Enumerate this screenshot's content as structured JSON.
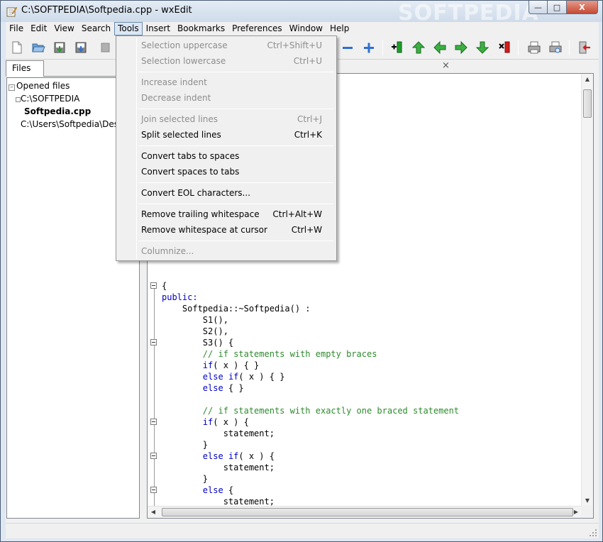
{
  "window": {
    "title": "C:\\SOFTPEDIA\\Softpedia.cpp - wxEdit",
    "watermark": "SOFTPEDIA",
    "minimize_glyph": "—",
    "maximize_glyph": "□",
    "close_glyph": "X"
  },
  "menubar": {
    "items": [
      {
        "label": "File"
      },
      {
        "label": "Edit"
      },
      {
        "label": "View"
      },
      {
        "label": "Search"
      },
      {
        "label": "Tools"
      },
      {
        "label": "Insert"
      },
      {
        "label": "Bookmarks"
      },
      {
        "label": "Preferences"
      },
      {
        "label": "Window"
      },
      {
        "label": "Help"
      }
    ],
    "active": "Tools"
  },
  "toolbar": {
    "icons": [
      "new-file-icon",
      "open-file-icon",
      "save-icon",
      "save-as-icon",
      "close-file-icon",
      "zoom-out-icon",
      "zoom-in-icon",
      "toggle-bookmark-icon",
      "first-bookmark-icon",
      "previous-bookmark-icon",
      "next-bookmark-icon",
      "last-bookmark-icon",
      "clear-bookmarks-icon",
      "print-icon",
      "print-preview-icon",
      "exit-icon"
    ],
    "colors": {
      "green": "#1f9e2a",
      "blue": "#2f6fd0",
      "red": "#d21c1c"
    }
  },
  "files_pane": {
    "tab_label": "Files",
    "tree": {
      "root": "Opened files",
      "folder1": "C:\\SOFTPEDIA",
      "file1": "Softpedia.cpp",
      "folder2": "C:\\Users\\Softpedia\\Desktop"
    }
  },
  "tools_menu": {
    "items": [
      {
        "label": "Selection uppercase",
        "shortcut": "Ctrl+Shift+U",
        "enabled": false
      },
      {
        "label": "Selection lowercase",
        "shortcut": "Ctrl+U",
        "enabled": false
      },
      {
        "label": "Increase indent",
        "shortcut": "",
        "enabled": false
      },
      {
        "label": "Decrease indent",
        "shortcut": "",
        "enabled": false
      },
      {
        "label": "Join selected lines",
        "shortcut": "Ctrl+J",
        "enabled": false
      },
      {
        "label": "Split selected lines",
        "shortcut": "Ctrl+K",
        "enabled": true
      },
      {
        "label": "Convert tabs to spaces",
        "shortcut": "",
        "enabled": true
      },
      {
        "label": "Convert spaces to tabs",
        "shortcut": "",
        "enabled": true
      },
      {
        "label": "Convert EOL characters...",
        "shortcut": "",
        "enabled": true
      },
      {
        "label": "Remove trailing whitespace",
        "shortcut": "Ctrl+Alt+W",
        "enabled": true
      },
      {
        "label": "Remove whitespace at cursor",
        "shortcut": "Ctrl+W",
        "enabled": true
      },
      {
        "label": "Columnize...",
        "shortcut": "",
        "enabled": false
      }
    ]
  },
  "editor": {
    "close_glyph": "×",
    "lines": [
      {
        "t": "{",
        "k": ""
      },
      {
        "t": "public:",
        "k": "kw"
      },
      {
        "t": "    Softpedia::~Softpedia() :",
        "k": ""
      },
      {
        "t": "        S1(),",
        "k": ""
      },
      {
        "t": "        S2(),",
        "k": ""
      },
      {
        "t": "        S3() {",
        "k": ""
      },
      {
        "t": "        // if statements with empty braces",
        "k": "cm"
      },
      {
        "t": "        if( x ) { }",
        "k": "if"
      },
      {
        "t": "        else if( x ) { }",
        "k": "elseif"
      },
      {
        "t": "        else { }",
        "k": "else"
      },
      {
        "t": "",
        "k": ""
      },
      {
        "t": "        // if statements with exactly one braced statement",
        "k": "cm"
      },
      {
        "t": "        if( x ) {",
        "k": "if"
      },
      {
        "t": "            statement;",
        "k": ""
      },
      {
        "t": "        }",
        "k": ""
      },
      {
        "t": "        else if( x ) {",
        "k": "elseif"
      },
      {
        "t": "            statement;",
        "k": ""
      },
      {
        "t": "        }",
        "k": ""
      },
      {
        "t": "        else {",
        "k": "else"
      },
      {
        "t": "            statement;",
        "k": ""
      },
      {
        "t": "        }",
        "k": ""
      }
    ],
    "fold_lines": [
      0,
      5,
      12,
      15,
      18
    ]
  }
}
